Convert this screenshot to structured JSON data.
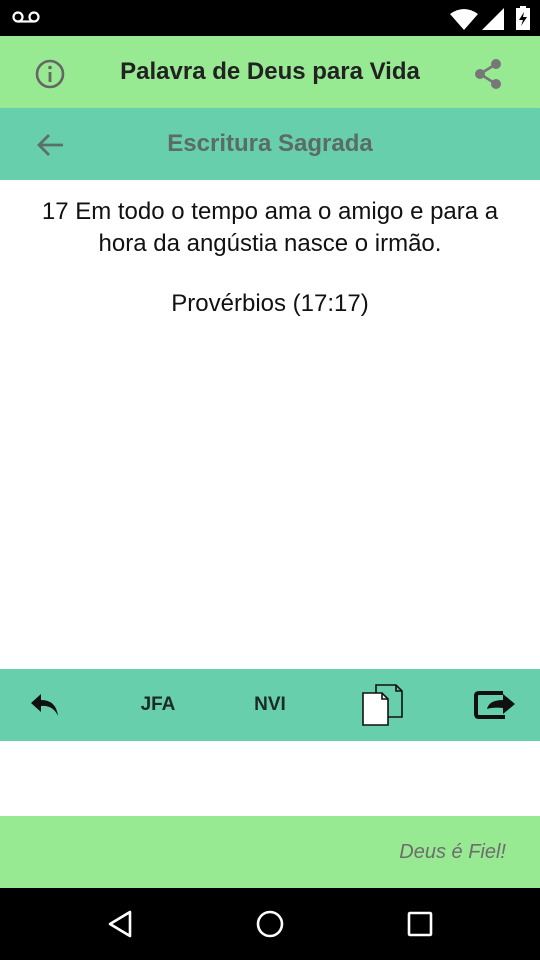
{
  "status_bar": {
    "icons": [
      "voicemail-icon",
      "wifi-icon",
      "cell-signal-icon",
      "battery-charging-icon"
    ]
  },
  "app_bar": {
    "title": "Palavra de Deus para Vida",
    "left_icon": "info-icon",
    "right_icon": "share-icon"
  },
  "sub_bar": {
    "title": "Escritura Sagrada",
    "left_icon": "arrow-left-icon"
  },
  "content": {
    "verse": "17 Em todo o tempo ama o amigo e para a hora da angústia nasce o irmão.",
    "reference": "Provérbios (17:17)"
  },
  "toolbar": {
    "back_icon": "reply-icon",
    "jfa_label": "JFA",
    "nvi_label": "NVI",
    "copy_icon": "copy-icon",
    "share_icon": "share-arrow-icon"
  },
  "footer": {
    "text": "Deus é Fiel!"
  },
  "nav_bar": {
    "icons": [
      "back-triangle-icon",
      "home-circle-icon",
      "recents-square-icon"
    ]
  },
  "colors": {
    "app_bar": "#97ea92",
    "sub_bar": "#67cfac"
  }
}
